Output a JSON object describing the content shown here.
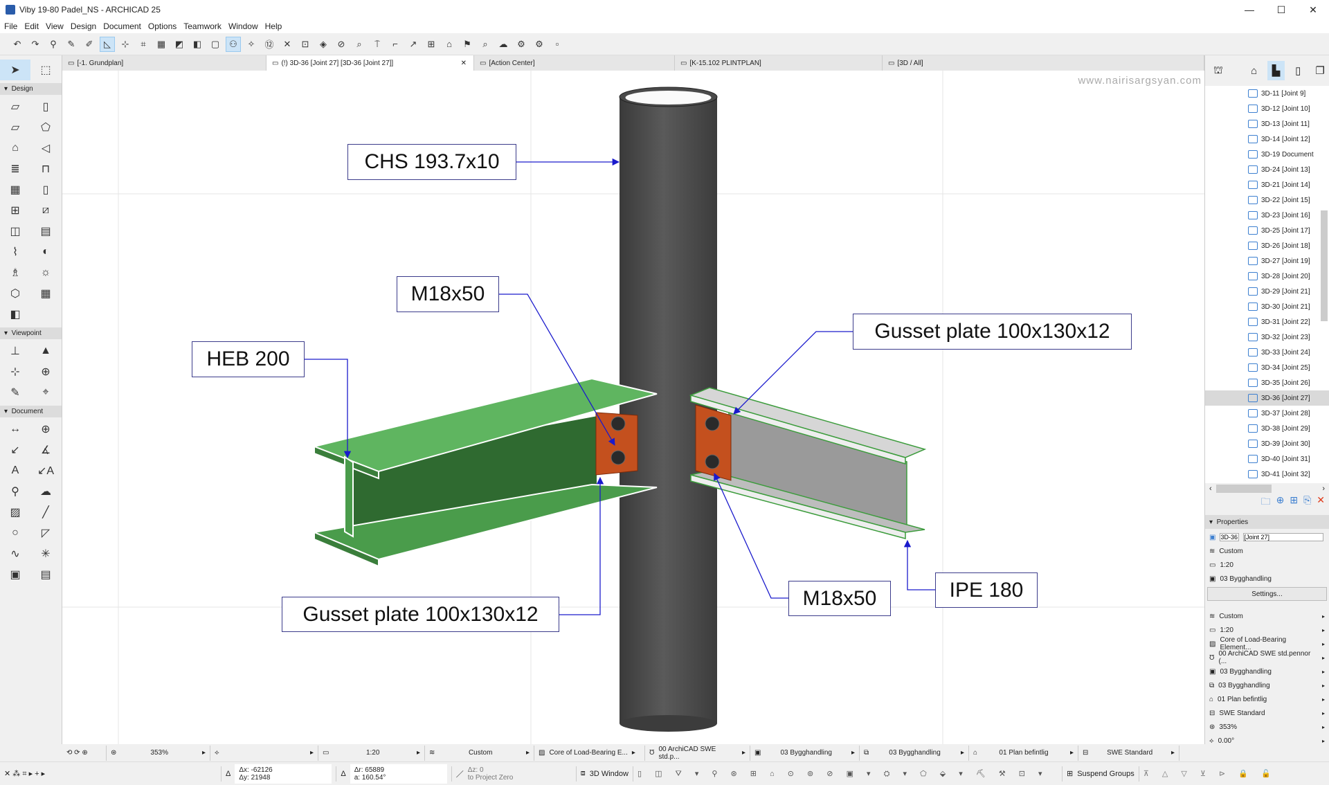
{
  "window": {
    "title": "Viby 19-80 Padel_NS - ARCHICAD 25",
    "controls": [
      "—",
      "☐",
      "✕"
    ]
  },
  "menu": [
    "File",
    "Edit",
    "View",
    "Design",
    "Document",
    "Options",
    "Teamwork",
    "Window",
    "Help"
  ],
  "toolbar_icons": [
    "undo",
    "redo",
    "pick-up",
    "syringe",
    "inject",
    "guide-lines",
    "snap",
    "xy-coords",
    "grid-snap",
    "fill",
    "wall-pen",
    "layer-box",
    "user",
    "magic-wand",
    "dimension-12",
    "cross",
    "trim",
    "box-select",
    "section",
    "split",
    "zoom-scale",
    "elevate",
    "corner",
    "adjust",
    "merge",
    "home",
    "flag",
    "find",
    "cloud",
    "teamwork-reserve",
    "teamwork-release"
  ],
  "tabs": [
    {
      "label": "[-1. Grundplan]",
      "active": false
    },
    {
      "label": "(!) 3D-36 [Joint 27] [3D-36 [Joint 27]]",
      "active": true,
      "close": "✕"
    },
    {
      "label": "[Action Center]",
      "active": false
    },
    {
      "label": "[K-15.102 PLINTPLAN]",
      "active": false
    },
    {
      "label": "[3D / All]",
      "active": false
    }
  ],
  "toolbox": {
    "sections": [
      {
        "title": "Design",
        "tools": [
          "wall",
          "column",
          "beam",
          "slab",
          "roof",
          "shell",
          "stair",
          "railing",
          "curtain-wall",
          "door",
          "window",
          "skylight",
          "wall-end",
          "object",
          "mesh",
          "morph",
          "chair",
          "lamp",
          "zone",
          "curtain-panel",
          "corner-window"
        ]
      },
      {
        "title": "Viewpoint",
        "tools": [
          "section",
          "elevation",
          "interior-elevation",
          "worksheet",
          "detail",
          "camera"
        ]
      },
      {
        "title": "Document",
        "tools": [
          "dimension",
          "radial-dimension",
          "level-dimension",
          "angle-dimension",
          "text",
          "label",
          "marker",
          "change",
          "fill",
          "line",
          "circle",
          "polyline",
          "spline",
          "hotspot",
          "figure",
          "drawing"
        ]
      }
    ]
  },
  "viewport": {
    "watermark": "www.nairisargsyan.com",
    "labels": {
      "chs": "CHS 193.7x10",
      "bolt_top": "M18x50",
      "heb": "HEB 200",
      "gusset_right": "Gusset plate 100x130x12",
      "gusset_left": "Gusset plate 100x130x12",
      "bolt_bottom": "M18x50",
      "ipe": "IPE 180"
    },
    "colors": {
      "column": "#4a4a4a",
      "heb": "#5fb560",
      "ipe": "#c8c8c8",
      "plate": "#c4501e",
      "leader": "#1a1acc"
    }
  },
  "navigator": {
    "items": [
      "3D-11 [Joint 9]",
      "3D-12 [Joint 10]",
      "3D-13 [Joint 11]",
      "3D-14 [Joint 12]",
      "3D-19 Document",
      "3D-24 [Joint 13]",
      "3D-21 [Joint 14]",
      "3D-22 [Joint 15]",
      "3D-23 [Joint 16]",
      "3D-25 [Joint 17]",
      "3D-26 [Joint 18]",
      "3D-27 [Joint 19]",
      "3D-28 [Joint 20]",
      "3D-29 [Joint 21]",
      "3D-30 [Joint 21]",
      "3D-31 [Joint 22]",
      "3D-32 [Joint 23]",
      "3D-33 [Joint 24]",
      "3D-34 [Joint 25]",
      "3D-35 [Joint 26]",
      "3D-36 [Joint 27]",
      "3D-37 [Joint 28]",
      "3D-38 [Joint 29]",
      "3D-39 [Joint 30]",
      "3D-40 [Joint 31]",
      "3D-41 [Joint 32]"
    ],
    "selected": "3D-36 [Joint 27]"
  },
  "properties": {
    "title": "Properties",
    "id": "3D-36",
    "name": "[Joint 27]",
    "layer": "Custom",
    "scale": "1:20",
    "renovation": "03 Bygghandling",
    "settings": "Settings...",
    "list": [
      "Custom",
      "1:20",
      "Core of Load-Bearing Element...",
      "00 ArchiCAD SWE std.pennor (...",
      "03 Bygghandling",
      "03 Bygghandling",
      "01 Plan befintlig",
      "SWE Standard",
      "353%",
      "0.00°"
    ]
  },
  "status1": {
    "zoom": "353%",
    "scale": "1:20",
    "layers": "Custom",
    "structure": "Core of Load-Bearing E...",
    "pens": "00 ArchiCAD SWE std.p...",
    "model_view": "03 Bygghandling",
    "renovation": "03 Bygghandling",
    "plan": "01 Plan befintlig",
    "dim": "SWE Standard"
  },
  "status2": {
    "dx": "Δx: -62126",
    "dy": "Δy: 21948",
    "dr": "Δr: 65889",
    "a": "a: 160.54°",
    "dz": "Δz: 0",
    "to": "to Project Zero",
    "window3d": "3D Window",
    "suspend": "Suspend Groups"
  }
}
